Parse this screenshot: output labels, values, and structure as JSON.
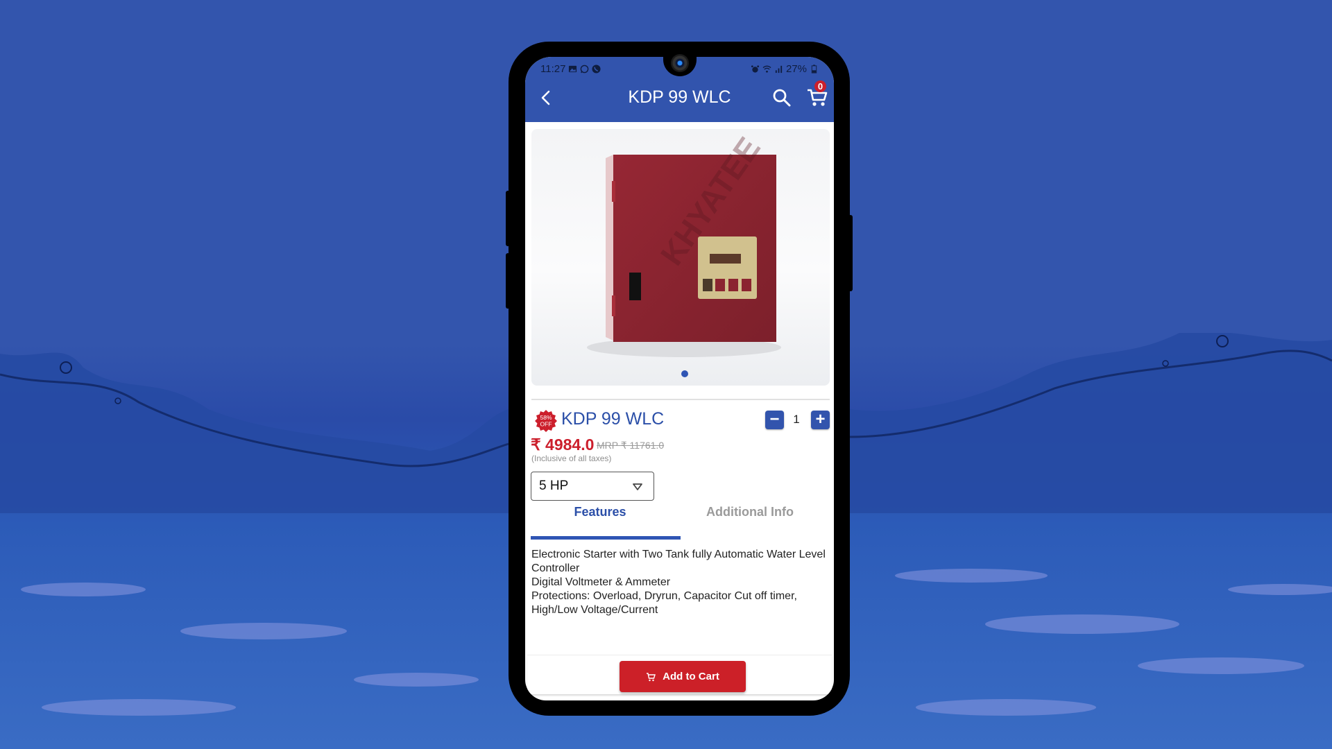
{
  "status_bar": {
    "time": "11:27",
    "battery": "27%",
    "left_icons": [
      "image-icon",
      "whatsapp-icon",
      "phone-icon"
    ],
    "right_icons": [
      "alarm-icon",
      "wifi-icon",
      "signal-icon",
      "battery-icon"
    ]
  },
  "app_bar": {
    "title": "KDP 99 WLC",
    "back_icon": "chevron-left-icon",
    "search_icon": "search-icon",
    "cart_icon": "cart-icon",
    "cart_count": "0"
  },
  "product": {
    "image_alt": "Red electrical starter panel box with digital controller",
    "watermark": "KHYATEE",
    "carousel": {
      "total": 1,
      "active": 1
    },
    "discount_badge": {
      "line1": "58%",
      "line2": "OFF"
    },
    "name": "KDP 99 WLC",
    "price": "₹ 4984.0",
    "mrp": "MRP ₹ 11761.0",
    "tax_note": "(Inclusive of all taxes)",
    "quantity": "1",
    "variant": "5 HP"
  },
  "tabs": [
    {
      "label": "Features",
      "active": true
    },
    {
      "label": "Additional Info",
      "active": false
    }
  ],
  "features": [
    "Electronic Starter with Two Tank fully Automatic Water Level Controller",
    "Digital Voltmeter & Ammeter",
    "Protections: Overload, Dryrun, Capacitor Cut off timer, High/Low Voltage/Current"
  ],
  "actions": {
    "add_to_cart": "Add to Cart"
  },
  "colors": {
    "primary": "#3254ad",
    "accent_red": "#cc2028",
    "background": "#3354ad"
  }
}
